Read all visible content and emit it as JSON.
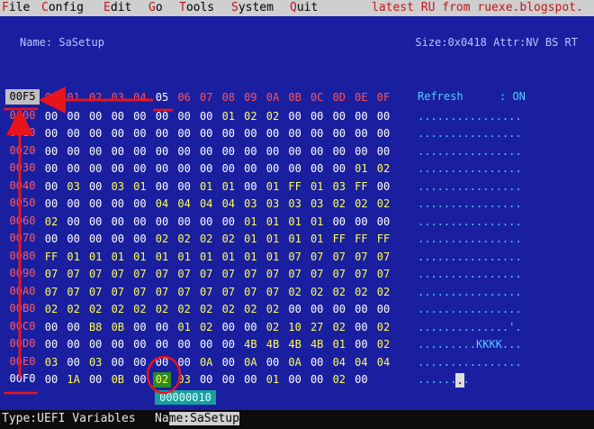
{
  "menubar": {
    "items": [
      "File",
      "Config",
      "Edit",
      "Go",
      "Tools",
      "System",
      "Quit"
    ],
    "note": "latest RU from ruexe.blogspot."
  },
  "info": {
    "name": "Name: SaSetup",
    "size_attr": "Size:0x0418 Attr:NV BS RT"
  },
  "header": {
    "offset": "00F5",
    "columns": [
      "00",
      "01",
      "02",
      "03",
      "04",
      "05",
      "06",
      "07",
      "08",
      "09",
      "0A",
      "0B",
      "0C",
      "0D",
      "0E",
      "0F"
    ],
    "current_column": "05"
  },
  "refresh": {
    "label": "Refresh",
    "value": ": ON"
  },
  "rows": [
    {
      "offset": "0000",
      "cells": [
        "00",
        "00",
        "00",
        "00",
        "00",
        "00",
        "00",
        "00",
        "01",
        "02",
        "02",
        "00",
        "00",
        "00",
        "00",
        "00"
      ],
      "ascii": "................"
    },
    {
      "offset": "0010",
      "cells": [
        "00",
        "00",
        "00",
        "00",
        "00",
        "00",
        "00",
        "00",
        "00",
        "00",
        "00",
        "00",
        "00",
        "00",
        "00",
        "00"
      ],
      "ascii": "................"
    },
    {
      "offset": "0020",
      "cells": [
        "00",
        "00",
        "00",
        "00",
        "00",
        "00",
        "00",
        "00",
        "00",
        "00",
        "00",
        "00",
        "00",
        "00",
        "00",
        "00"
      ],
      "ascii": "................"
    },
    {
      "offset": "0030",
      "cells": [
        "00",
        "00",
        "00",
        "00",
        "00",
        "00",
        "00",
        "00",
        "00",
        "00",
        "00",
        "00",
        "00",
        "00",
        "01",
        "02"
      ],
      "ascii": "................"
    },
    {
      "offset": "0040",
      "cells": [
        "00",
        "03",
        "00",
        "03",
        "01",
        "00",
        "00",
        "01",
        "01",
        "00",
        "01",
        "FF",
        "01",
        "03",
        "FF",
        "00"
      ],
      "ascii": "................"
    },
    {
      "offset": "0050",
      "cells": [
        "00",
        "00",
        "00",
        "00",
        "00",
        "04",
        "04",
        "04",
        "04",
        "03",
        "03",
        "03",
        "03",
        "02",
        "02",
        "02"
      ],
      "ascii": "................"
    },
    {
      "offset": "0060",
      "cells": [
        "02",
        "00",
        "00",
        "00",
        "00",
        "00",
        "00",
        "00",
        "00",
        "01",
        "01",
        "01",
        "01",
        "00",
        "00",
        "00"
      ],
      "ascii": "................"
    },
    {
      "offset": "0070",
      "cells": [
        "00",
        "00",
        "00",
        "00",
        "00",
        "02",
        "02",
        "02",
        "02",
        "01",
        "01",
        "01",
        "01",
        "FF",
        "FF",
        "FF"
      ],
      "ascii": "................"
    },
    {
      "offset": "0080",
      "cells": [
        "FF",
        "01",
        "01",
        "01",
        "01",
        "01",
        "01",
        "01",
        "01",
        "01",
        "01",
        "07",
        "07",
        "07",
        "07",
        "07"
      ],
      "ascii": "................"
    },
    {
      "offset": "0090",
      "cells": [
        "07",
        "07",
        "07",
        "07",
        "07",
        "07",
        "07",
        "07",
        "07",
        "07",
        "07",
        "07",
        "07",
        "07",
        "07",
        "07"
      ],
      "ascii": "................"
    },
    {
      "offset": "00A0",
      "cells": [
        "07",
        "07",
        "07",
        "07",
        "07",
        "07",
        "07",
        "07",
        "07",
        "07",
        "07",
        "02",
        "02",
        "02",
        "02",
        "02"
      ],
      "ascii": "................"
    },
    {
      "offset": "00B0",
      "cells": [
        "02",
        "02",
        "02",
        "02",
        "02",
        "02",
        "02",
        "02",
        "02",
        "02",
        "02",
        "00",
        "00",
        "00",
        "00",
        "00"
      ],
      "ascii": "................"
    },
    {
      "offset": "00C0",
      "cells": [
        "00",
        "00",
        "B8",
        "0B",
        "00",
        "00",
        "01",
        "02",
        "00",
        "00",
        "02",
        "10",
        "27",
        "02",
        "00",
        "02"
      ],
      "ascii": "..............'."
    },
    {
      "offset": "00D0",
      "cells": [
        "00",
        "00",
        "00",
        "00",
        "00",
        "00",
        "00",
        "00",
        "00",
        "4B",
        "4B",
        "4B",
        "4B",
        "01",
        "00",
        "02"
      ],
      "ascii": ".........KKKK..."
    },
    {
      "offset": "00E0",
      "cells": [
        "03",
        "00",
        "03",
        "00",
        "00",
        "00",
        "00",
        "0A",
        "00",
        "0A",
        "00",
        "0A",
        "00",
        "04",
        "04",
        "04"
      ],
      "ascii": "................"
    },
    {
      "offset": "00F0",
      "cells": [
        "00",
        "1A",
        "00",
        "0B",
        "00",
        "02",
        "03",
        "00",
        "00",
        "00",
        "01",
        "00",
        "00",
        "02",
        "00",
        ""
      ],
      "ascii": "........"
    }
  ],
  "cursor_char": ".",
  "address": "00000010",
  "status": {
    "type": "Type:UEFI Variables",
    "name_prefix": "Na",
    "name_rest": "me:SaSetup"
  },
  "colors": {
    "background": "#1a1fa0",
    "menubar": "#cfcfcf",
    "accent_red": "#c01818",
    "annotation": "#e8141c",
    "selected_cell": "#2a8a2a"
  }
}
